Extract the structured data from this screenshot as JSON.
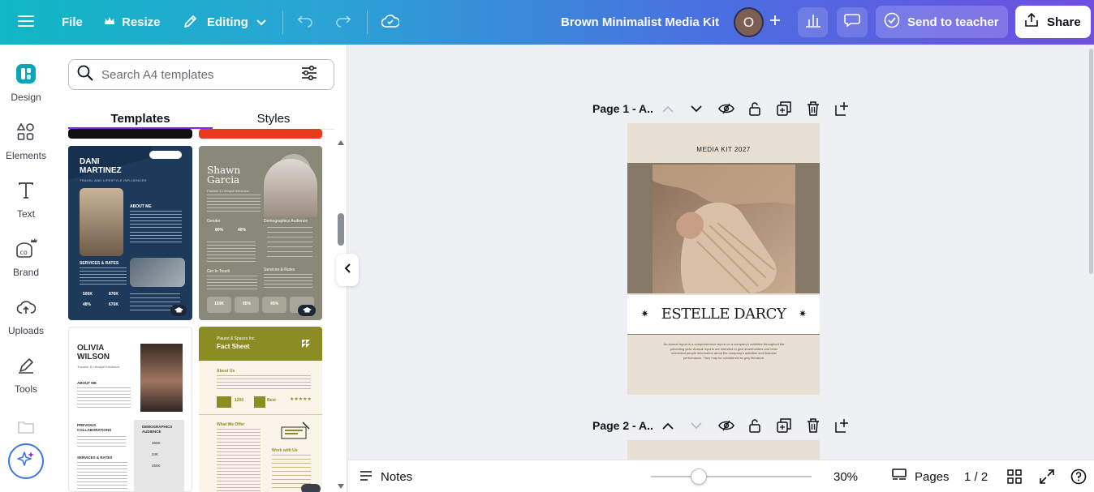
{
  "topbar": {
    "file_label": "File",
    "resize_label": "Resize",
    "editing_label": "Editing",
    "doc_title": "Brown Minimalist Media Kit",
    "avatar_initial": "O",
    "send_label": "Send to teacher",
    "share_label": "Share"
  },
  "rail": {
    "items": [
      {
        "label": "Design"
      },
      {
        "label": "Elements"
      },
      {
        "label": "Text"
      },
      {
        "label": "Brand"
      },
      {
        "label": "Uploads"
      },
      {
        "label": "Tools"
      }
    ]
  },
  "panel": {
    "search_placeholder": "Search A4 templates",
    "tabs": [
      {
        "label": "Templates"
      },
      {
        "label": "Styles"
      }
    ],
    "templates": [
      {
        "name": "DANI\nMARTINEZ",
        "subtitle": "TRAVEL AND LIFESTYLE INFLUENCER",
        "section1": "ABOUT ME",
        "section2": "SERVICES & RATES",
        "stats": [
          "500K",
          "876K",
          "48%",
          "670K"
        ]
      },
      {
        "name": "Shawn\nGarcia",
        "subtitle": "Fashion & Lifestyle Influencer",
        "section1": "Gender",
        "section2": "Demographics Audience",
        "section3": "Get In Touch",
        "section4": "Services & Rates",
        "stats": [
          "80%",
          "40%",
          "150K",
          "95%",
          "45%"
        ]
      },
      {
        "name": "OLIVIA\nWILSON",
        "subtitle": "Traveler & Lifestyle Influencer",
        "section1": "ABOUT ME",
        "section2": "PREVIOUS COLLABORATIONS",
        "section3": "DEMOGRAPHICS AUDIENCE",
        "section4": "SERVICES & RATES",
        "stats": [
          "350K",
          "24K",
          "450K"
        ]
      },
      {
        "company": "Plaueo & Spaces Inc.",
        "name": "Fact Sheet",
        "section1": "About Us",
        "section2": "What We Offer",
        "section3": "Work with Us",
        "stats": [
          "1200",
          "Best"
        ]
      }
    ]
  },
  "canvas": {
    "page1_label": "Page 1 - A..",
    "page2_label": "Page 2 - A..",
    "page1": {
      "header": "MEDIA KIT 2027",
      "name": "ESTELLE DARCY",
      "body": "An annual report is a comprehensive report on a company's activities throughout the preceding year. Annual reports are intended to give shareholders and other interested people information about the company's activities and financial performance. They may be considered as grey literature."
    }
  },
  "bottombar": {
    "notes_label": "Notes",
    "zoom_label": "30%",
    "zoom_value": 30,
    "pages_label": "Pages",
    "page_counter": "1 / 2"
  }
}
